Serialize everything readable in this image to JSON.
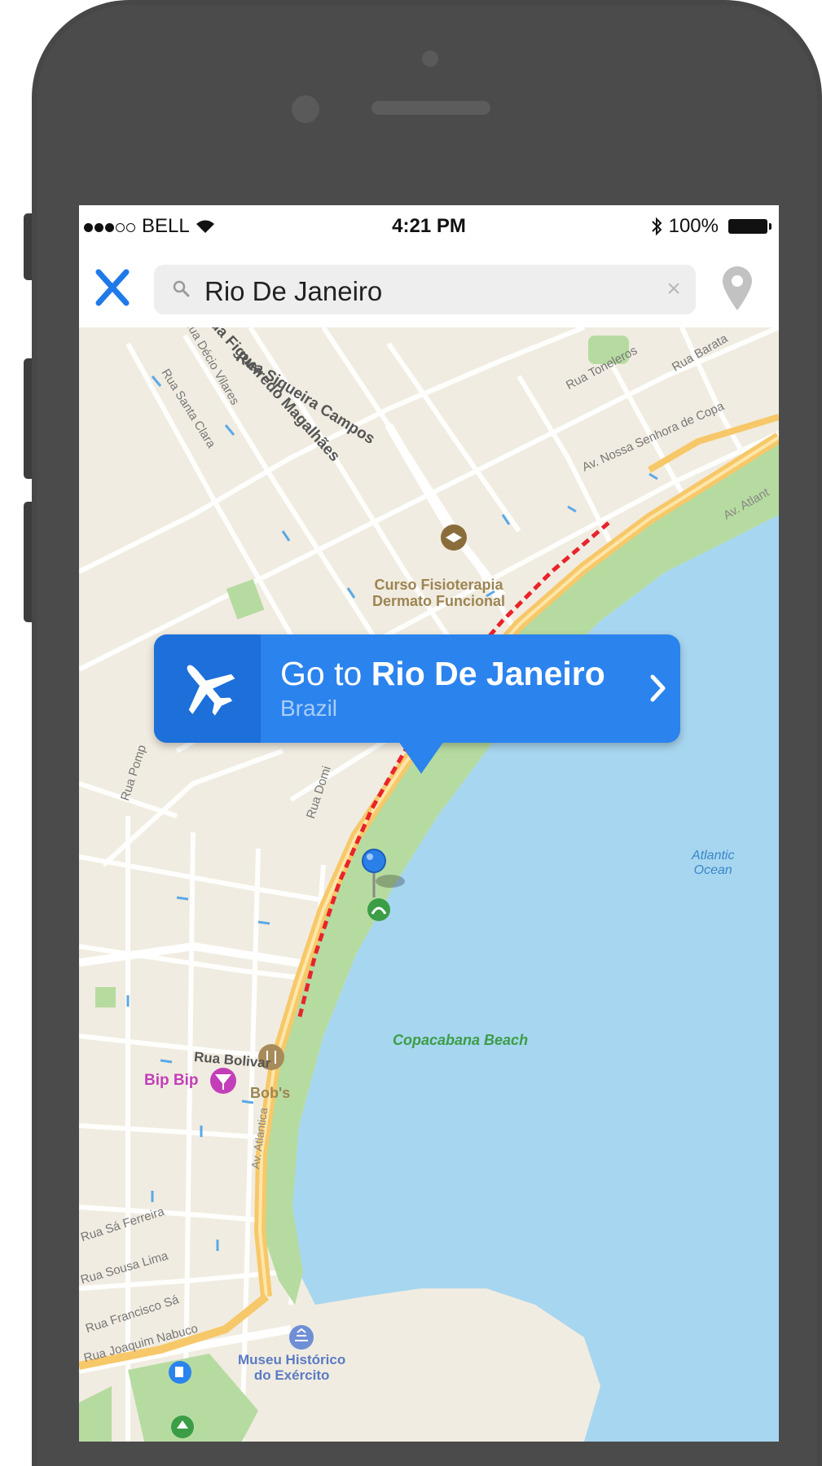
{
  "status_bar": {
    "carrier": "BELL",
    "time": "4:21 PM",
    "battery": "100%",
    "icons": [
      "signal-dots-icon",
      "wifi-icon",
      "bluetooth-icon",
      "battery-icon"
    ]
  },
  "search": {
    "query": "Rio De Janeiro",
    "icons": [
      "close-x-icon",
      "magnifier-icon",
      "clear-icon",
      "location-pin-icon"
    ]
  },
  "callout": {
    "prefix": "Go to",
    "destination": "Rio De Janeiro",
    "subtitle": "Brazil",
    "icons": [
      "airplane-icon",
      "chevron-right-icon"
    ]
  },
  "map": {
    "streets": [
      "Rua Siqueira Campos",
      "Rua Figueiredo Magalhães",
      "Rua Décio Vilares",
      "Rua Santa Clara",
      "Rua Toneleros",
      "Rua Barata",
      "Av. Nossa Senhora de Copa",
      "Av. Atlant",
      "Rua Bolivar",
      "Rua Pomp",
      "Rua Domi",
      "Rua Sá Ferreira",
      "Rua Sousa Lima",
      "Rua Francisco Sá",
      "Rua Joaquim Nabuco",
      "Av. Atlantica"
    ],
    "pois": [
      {
        "line1": "Curso Fisioterapia",
        "line2": "Dermato Funcional"
      },
      {
        "line1": "Copacabana Beach",
        "line2": ""
      },
      {
        "line1": "Bip Bip",
        "line2": ""
      },
      {
        "line1": "Bob's",
        "line2": ""
      },
      {
        "line1": "Museu Histórico",
        "line2": "do Exército"
      }
    ],
    "water": {
      "line1": "Atlantic",
      "line2": "Ocean"
    },
    "colors": {
      "land": "#f1ece1",
      "water": "#a7d6f0",
      "park": "#b6dba0",
      "highway": "#f7c869",
      "route": "#e8232b",
      "accent": "#2b83ee"
    }
  }
}
